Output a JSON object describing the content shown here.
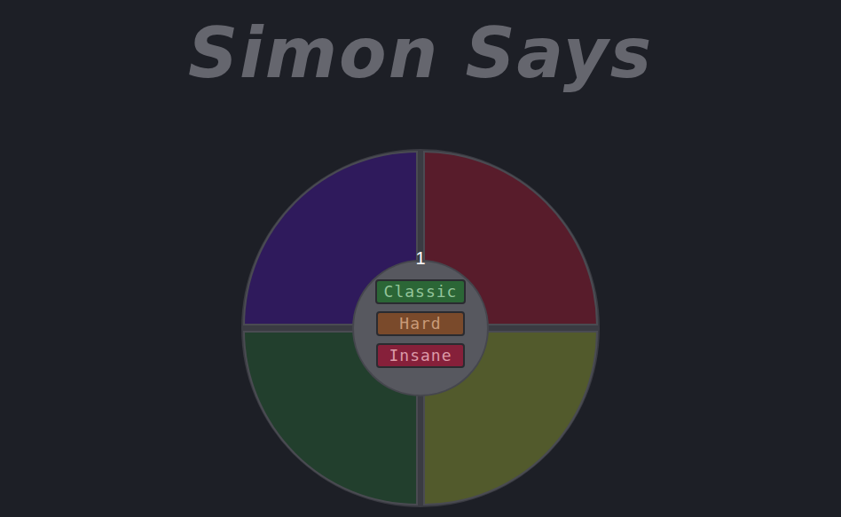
{
  "title": "Simon Says",
  "counter": "1",
  "pads": [
    {
      "name": "purple",
      "color": "#2f1a5c"
    },
    {
      "name": "red",
      "color": "#581c2b"
    },
    {
      "name": "green",
      "color": "#223f2d"
    },
    {
      "name": "yellow",
      "color": "#525a2c"
    }
  ],
  "modes": [
    {
      "label": "Classic",
      "color": "#2b6636",
      "text": "#93c49a"
    },
    {
      "label": "Hard",
      "color": "#7a4a2b",
      "text": "#c99a78"
    },
    {
      "label": "Insane",
      "color": "#86203a",
      "text": "#dc9aa8"
    }
  ]
}
